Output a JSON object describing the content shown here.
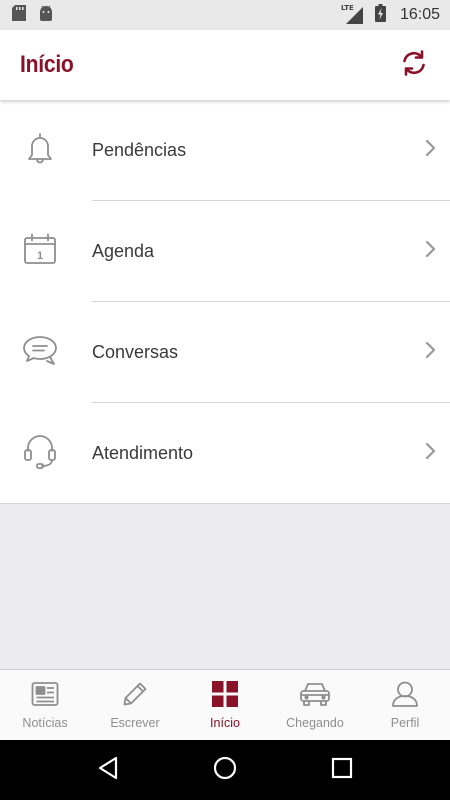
{
  "status_bar": {
    "time": "16:05",
    "network": "LTE",
    "icons": [
      "sd-card-icon",
      "android-icon",
      "signal-icon",
      "battery-icon"
    ]
  },
  "header": {
    "title": "Início",
    "refresh_icon": "refresh-icon"
  },
  "menu": {
    "items": [
      {
        "label": "Pendências",
        "icon": "bell-icon"
      },
      {
        "label": "Agenda",
        "icon": "calendar-icon",
        "icon_text": "1"
      },
      {
        "label": "Conversas",
        "icon": "chat-icon"
      },
      {
        "label": "Atendimento",
        "icon": "headset-icon"
      }
    ]
  },
  "bottom_nav": {
    "active_tab": "Início",
    "tabs": [
      {
        "label": "Notícias",
        "icon": "newspaper-icon"
      },
      {
        "label": "Escrever",
        "icon": "pencil-icon"
      },
      {
        "label": "Início",
        "icon": "grid-icon"
      },
      {
        "label": "Chegando",
        "icon": "car-icon"
      },
      {
        "label": "Perfil",
        "icon": "person-icon"
      }
    ]
  },
  "system_nav": {
    "buttons": [
      "back-icon",
      "home-icon",
      "recents-icon"
    ]
  },
  "colors": {
    "brand": "#8a1228",
    "icon_gray": "#8e8e8e",
    "background": "#ebebf0"
  }
}
